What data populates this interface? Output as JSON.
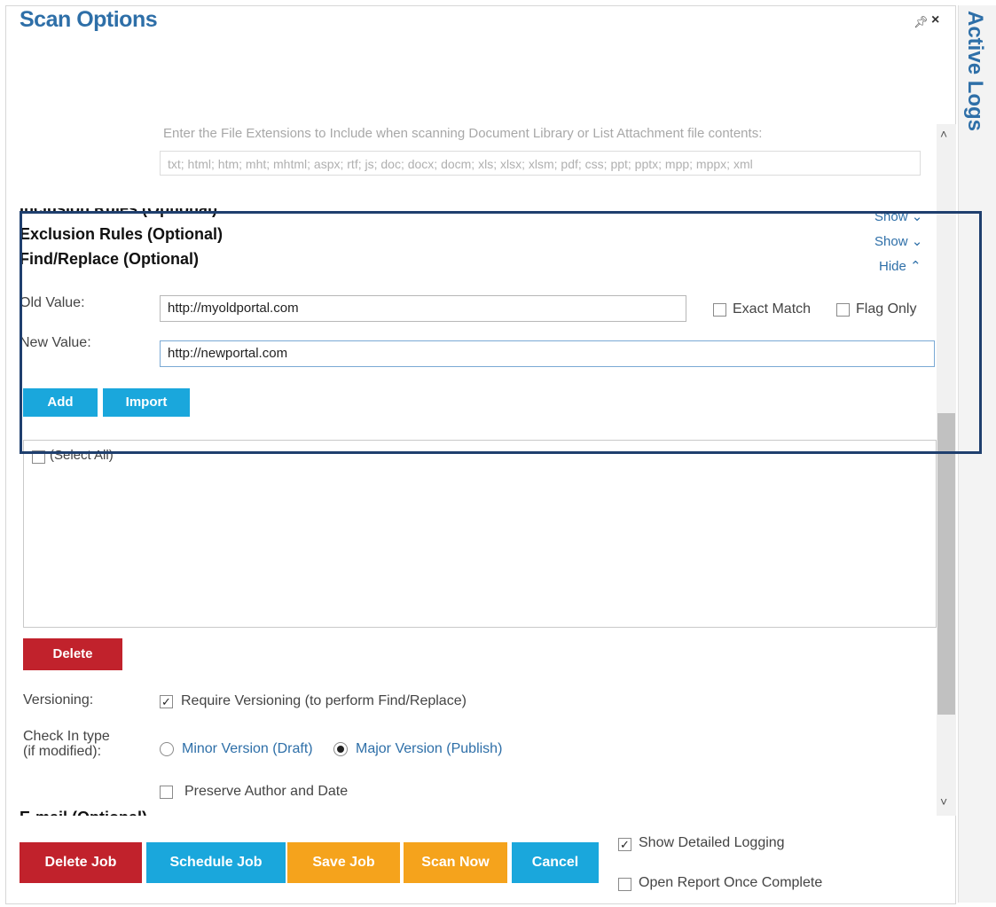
{
  "header": {
    "title": "Scan Options",
    "pin_glyph": "†",
    "close_glyph": "×",
    "side_tab": "Active Logs"
  },
  "file_extensions": {
    "hint": "Enter the File Extensions to Include when scanning Document Library or List Attachment file contents:",
    "placeholder": "txt; html; htm; mht; mhtml; aspx; rtf; js; doc; docx; docm; xls; xlsx; xlsm; pdf; css; ppt; pptx; mpp; mppx; xml"
  },
  "sections": {
    "inclusion": {
      "title": "Inclusion Rules (Optional)",
      "toggle": "Show"
    },
    "exclusion": {
      "title": "Exclusion Rules (Optional)",
      "toggle": "Show"
    },
    "find_replace": {
      "title": "Find/Replace (Optional)",
      "toggle": "Hide"
    },
    "email": {
      "title": "E-mail (Optional)"
    }
  },
  "find_replace": {
    "old_label": "Old Value:",
    "old_value": "http://myoldportal.com",
    "new_label": "New Value:",
    "new_value": "http://newportal.com",
    "exact_match": "Exact Match",
    "flag_only": "Flag Only",
    "add_label": "Add",
    "import_label": "Import",
    "select_all": "(Select All)",
    "delete_label": "Delete"
  },
  "versioning": {
    "label": "Versioning:",
    "require_label": "Require Versioning (to perform Find/Replace)",
    "require_checked": true,
    "checkin_label_1": "Check In type",
    "checkin_label_2": "(if modified):",
    "minor_label": "Minor Version (Draft)",
    "major_label": "Major Version (Publish)",
    "selected": "major",
    "preserve_label": "Preserve Author and Date"
  },
  "footer": {
    "delete_job": "Delete Job",
    "schedule_job": "Schedule Job",
    "save_job": "Save Job",
    "scan_now": "Scan Now",
    "cancel": "Cancel",
    "show_logging": "Show Detailed Logging",
    "show_logging_checked": true,
    "open_report": "Open Report Once Complete",
    "open_report_checked": false
  },
  "icons": {
    "check": "✓",
    "chevron_down": "˅",
    "chevron_up": "˄"
  },
  "colors": {
    "accent": "#2e6fa8",
    "blue_button": "#1aa7dc",
    "red_button": "#c1222c",
    "orange_button": "#f5a31c",
    "highlight_border": "#1f3f6e"
  }
}
